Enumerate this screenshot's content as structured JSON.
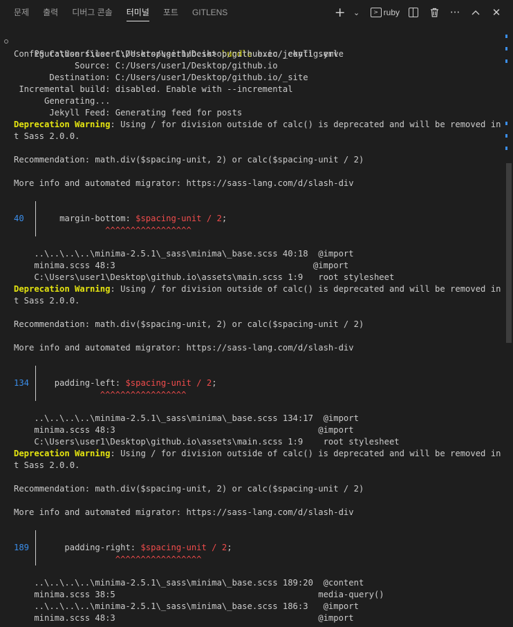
{
  "tabs": [
    {
      "label": "문제"
    },
    {
      "label": "출력"
    },
    {
      "label": "디버그 콘솔"
    },
    {
      "label": "터미널"
    },
    {
      "label": "포트"
    },
    {
      "label": "GITLENS"
    }
  ],
  "toolbar": {
    "add_icon": "+",
    "dropdown_icon": "⌄",
    "terminal_name": "ruby",
    "more_icon": "···",
    "maximize_icon": "^",
    "close_icon": "✕"
  },
  "terminal": {
    "prompt": "PS C:\\Users\\user1\\Desktop\\github.io> ",
    "command": "bundle",
    "command_rest": " exec jekyll serve",
    "config_lines": [
      "Configuration file: C:/Users/user1/Desktop/github.io/_config.yml",
      "            Source: C:/Users/user1/Desktop/github.io",
      "       Destination: C:/Users/user1/Desktop/github.io/_site",
      " Incremental build: disabled. Enable with --incremental",
      "      Generating...",
      "       Jekyll Feed: Generating feed for posts"
    ],
    "warning_label": "Deprecation Warning",
    "warning_text_1": ": Using / for division outside of calc() is deprecated and will be removed in Dar",
    "warning_text_2": "t Sass 2.0.0.",
    "recommendation": "Recommendation: math.div($spacing-unit, 2) or calc($spacing-unit / 2)",
    "more_info": "More info and automated migrator: https://sass-lang.com/d/slash-div",
    "blocks": [
      {
        "line_no": "40",
        "code_indent": "    ",
        "property": "margin-bottom: ",
        "error_expr": "$spacing-unit / 2",
        "semicolon": ";",
        "squiggle_pad": "                  ",
        "squiggle": "^^^^^^^^^^^^^^^^^",
        "trace": [
          "    ..\\..\\..\\..\\minima-2.5.1\\_sass\\minima\\_base.scss 40:18  @import",
          "    minima.scss 48:3                                       @import",
          "    C:\\Users\\user1\\Desktop\\github.io\\assets\\main.scss 1:9   root stylesheet"
        ]
      },
      {
        "line_no": "134",
        "code_indent": "   ",
        "property": "padding-left: ",
        "error_expr": "$spacing-unit / 2",
        "semicolon": ";",
        "squiggle_pad": "                 ",
        "squiggle": "^^^^^^^^^^^^^^^^^",
        "trace": [
          "    ..\\..\\..\\..\\minima-2.5.1\\_sass\\minima\\_base.scss 134:17  @import",
          "    minima.scss 48:3                                        @import",
          "    C:\\Users\\user1\\Desktop\\github.io\\assets\\main.scss 1:9    root stylesheet"
        ]
      },
      {
        "line_no": "189",
        "code_indent": "     ",
        "property": "padding-right: ",
        "error_expr": "$spacing-unit / 2",
        "semicolon": ";",
        "squiggle_pad": "                    ",
        "squiggle": "^^^^^^^^^^^^^^^^^",
        "trace": [
          "    ..\\..\\..\\..\\minima-2.5.1\\_sass\\minima\\_base.scss 189:20  @content",
          "    minima.scss 38:5                                        media-query()",
          "    ..\\..\\..\\..\\minima-2.5.1\\_sass\\minima\\_base.scss 186:3   @import",
          "    minima.scss 48:3                                        @import"
        ]
      }
    ]
  },
  "colors": {
    "background": "#1e1e1e",
    "text": "#cccccc",
    "warning": "#e5e510",
    "error": "#f14c4c",
    "line_number": "#3b8eea"
  }
}
